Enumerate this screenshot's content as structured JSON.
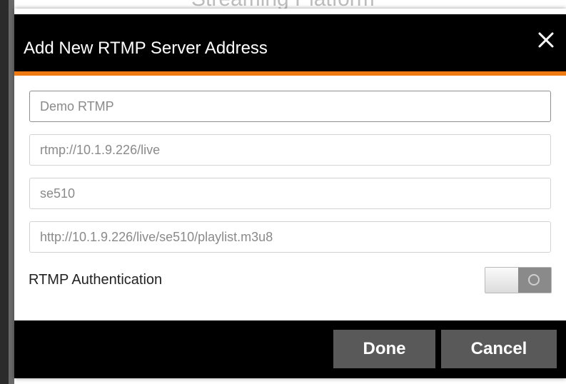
{
  "background": {
    "page_title": "Streaming Platform"
  },
  "dialog": {
    "title": "Add New RTMP Server Address",
    "close_icon": "close-icon",
    "accent_color": "#f07a12",
    "fields": {
      "name": {
        "value": "",
        "placeholder": "Demo RTMP"
      },
      "rtmp_url": {
        "value": "",
        "placeholder": "rtmp://10.1.9.226/live"
      },
      "stream_key": {
        "value": "",
        "placeholder": "se510"
      },
      "playback_url": {
        "value": "",
        "placeholder": "http://10.1.9.226/live/se510/playlist.m3u8"
      }
    },
    "auth": {
      "label": "RTMP Authentication",
      "enabled": false
    },
    "buttons": {
      "done": "Done",
      "cancel": "Cancel"
    }
  }
}
